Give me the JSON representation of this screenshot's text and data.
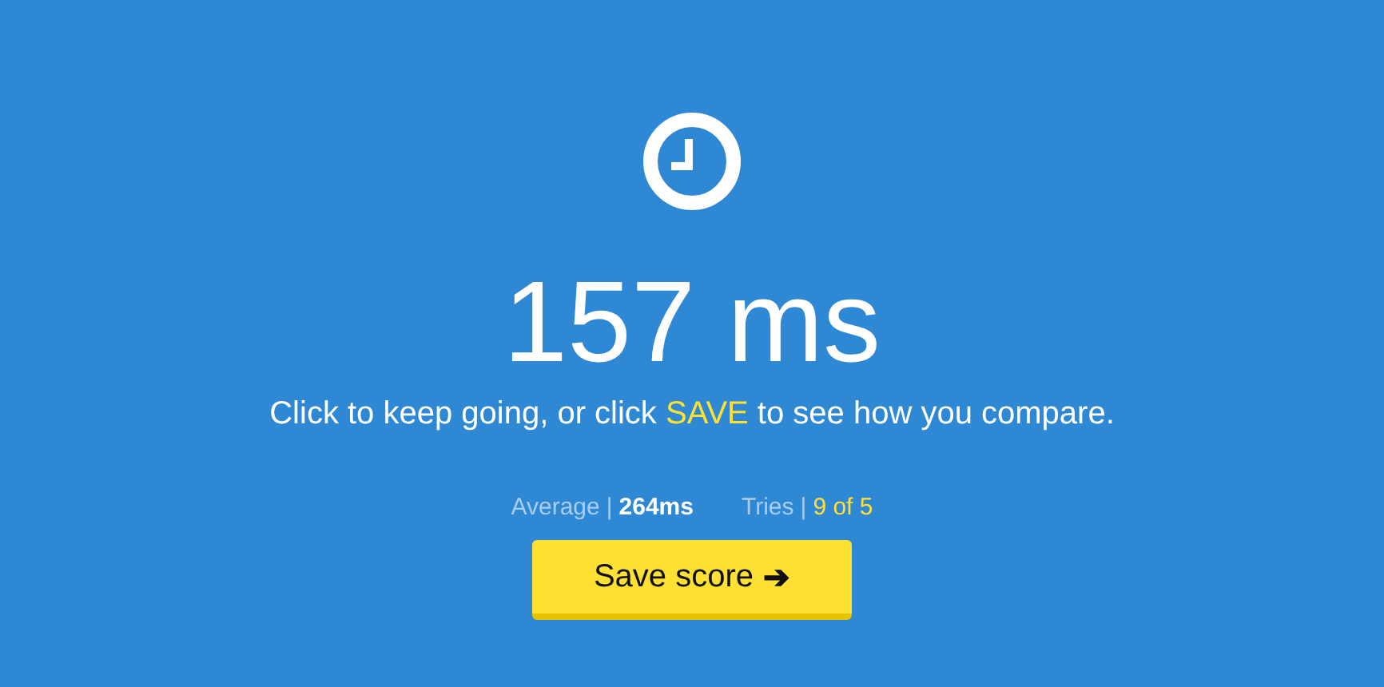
{
  "result": {
    "time": "157 ms"
  },
  "message": {
    "before": "Click to keep going, or click ",
    "highlight": "SAVE",
    "after": " to see how you compare."
  },
  "stats": [
    {
      "label": "Average",
      "separator": "|",
      "value": "264ms",
      "color": "#ffffff"
    },
    {
      "label": "Tries",
      "separator": "|",
      "value": "9 of 5",
      "color": "#ffe033"
    }
  ],
  "button": {
    "label": "Save score",
    "arrow": "➔"
  }
}
